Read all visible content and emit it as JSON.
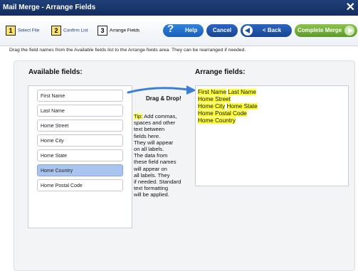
{
  "window": {
    "title": "Mail Merge - Arrange Fields",
    "close_glyph": "✕"
  },
  "steps": [
    {
      "number": "1",
      "label": "Select File"
    },
    {
      "number": "2",
      "label": "Confirm List"
    },
    {
      "number": "3",
      "label": "Arrange Fields"
    }
  ],
  "buttons": {
    "help": "Help",
    "help_glyph": "?",
    "cancel": "Cancel",
    "back": "< Back",
    "complete": "Complete Merge"
  },
  "instructions": "Drag the field names from the Available fields list to the Arrange fields area. They can be rearranged if needed.",
  "available": {
    "heading": "Available fields:",
    "fields": [
      "First Name",
      "Last Name",
      "Home Street",
      "Home City",
      "Home State",
      "Home Country",
      "Home Postal Code"
    ],
    "selected": "Home Country"
  },
  "dnd": {
    "title": "Drag & Drop!",
    "tip_label": "Tip:",
    "tip_lines": [
      " Add commas,",
      "spaces and other",
      "text between",
      "fields here.",
      "They will appear",
      "on all labels.",
      "The data from",
      "these field names",
      "will appear on",
      "all labels. They",
      "if needed. Standard",
      "text formatting",
      "will be applied."
    ]
  },
  "arrange": {
    "heading": "Arrange fields:",
    "line1_a": "First Name",
    "line1_b": "Last Name",
    "line2": "Home Street",
    "line3_a": "Home City",
    "line3_b": "Home State",
    "line4": "Home Postal Code",
    "line5": "Home Country"
  },
  "colors": {
    "title_bar": "#1f3f7a",
    "selected_field": "#a9c4ee",
    "highlight": "#ffff33",
    "complete": "#7ab33e",
    "accent": "#2a66c4"
  }
}
